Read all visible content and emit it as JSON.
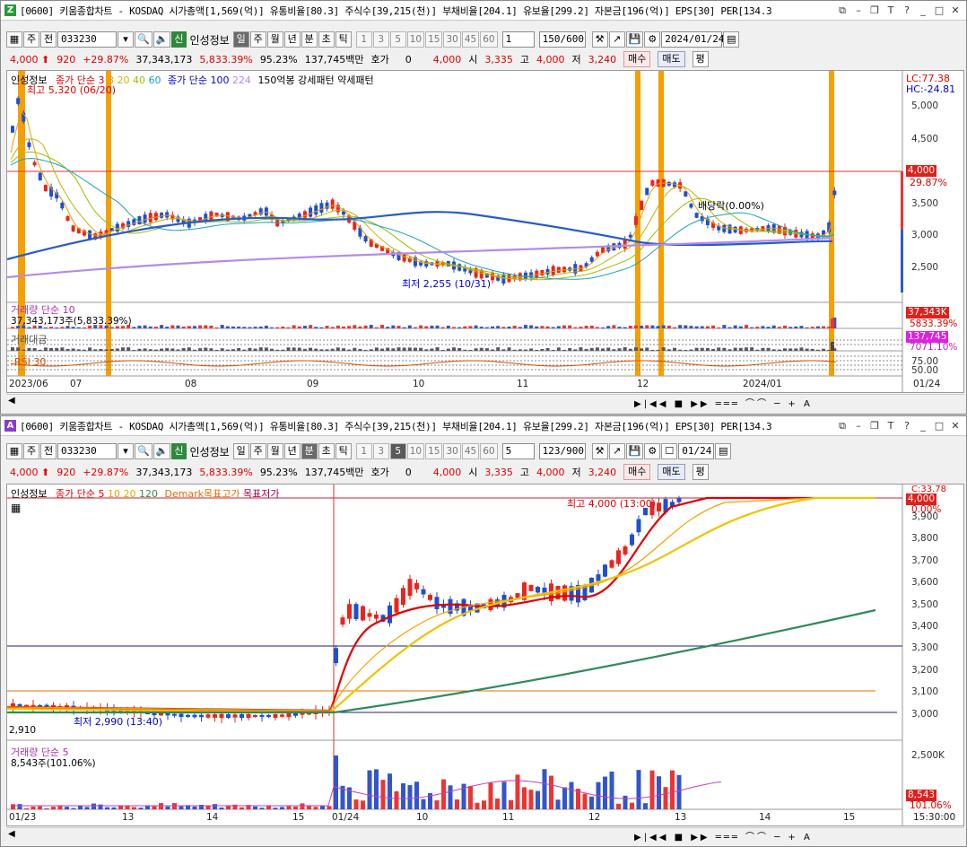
{
  "top": {
    "badge": "Z",
    "title": "[0600] 키움종합차트 - KOSDAQ 시가총액[1,569(억)] 유통비율[80.3] 주식수[39,215(천)] 부채비율[204.1] 유보율[299.2] 자본금[196(억)] EPS[30] PER[134.3",
    "toolbar": {
      "unit": "주",
      "prev": "전",
      "code": "033230",
      "news": "신",
      "name": "인성정보",
      "periods": [
        "일",
        "주",
        "월",
        "년",
        "분",
        "초",
        "틱"
      ],
      "active_period": "일",
      "nums": [
        "1",
        "3",
        "5",
        "10",
        "15",
        "30",
        "45",
        "60"
      ],
      "num_sel": "1",
      "count": "150/600",
      "date": "2024/01/24"
    },
    "quote": {
      "price": "4,000",
      "change": "920",
      "rate": "+29.87%",
      "volume": "37,343,173",
      "vol_rate": "5,833.39%",
      "ratio": "95.23%",
      "amount": "137,745백만",
      "hoga_label": "호가",
      "hoga_val": "0",
      "hoga_price": "4,000",
      "open_label": "시",
      "open": "3,335",
      "high_label": "고",
      "high": "4,000",
      "low_label": "저",
      "low": "3,240",
      "buy": "매수",
      "sell": "매도",
      "eval": "평"
    },
    "legend": {
      "name": "인성정보",
      "ma_label": "종가 단순 3",
      "ma_vals": [
        "8",
        "20",
        "40",
        "60"
      ],
      "ma2_label": "종가 단순 100",
      "ma2_val": "224",
      "pattern": "150억봉 강세패턴",
      "pattern2": "약세패턴"
    },
    "annotations": {
      "high": "최고 5,320 (06/20)",
      "low": "최저 2,255 (10/31)",
      "dividend": "배당락(0.00%)"
    },
    "right": {
      "lc": "LC:77.38",
      "hc": "HC:-24.81",
      "price_tag": "4,000",
      "pct_tag": "29.87%",
      "y_ticks": [
        "5,000",
        "4,500",
        "4,000",
        "3,500",
        "3,000",
        "2,500"
      ]
    },
    "vol_panel": {
      "label": "거래량",
      "ma": "단순 10",
      "value": "37,343,173주(5,833.39%)",
      "tag": "37,343K",
      "tag_pct": "5833.39%"
    },
    "amt_panel": {
      "label": "거래대금",
      "tag": "137,745",
      "tag_pct": "7071.10%"
    },
    "rsi_panel": {
      "label": "RSI 30",
      "ticks": [
        "75.00",
        "50.00"
      ]
    },
    "x_labels": [
      "2023/06",
      "07",
      "08",
      "09",
      "10",
      "11",
      "12",
      "2024/01",
      "01/24"
    ]
  },
  "bottom": {
    "badge": "A",
    "title": "[0600] 키움종합차트 - KOSDAQ 시가총액[1,569(억)] 유통비율[80.3] 주식수[39,215(천)] 부채비율[204.1] 유보율[299.2] 자본금[196(억)] EPS[30] PER[134.3",
    "toolbar": {
      "unit": "주",
      "prev": "전",
      "code": "033230",
      "news": "신",
      "name": "인성정보",
      "periods": [
        "일",
        "주",
        "월",
        "년",
        "분",
        "초",
        "틱"
      ],
      "active_period": "분",
      "nums": [
        "1",
        "3",
        "5",
        "10",
        "15",
        "30",
        "45",
        "60"
      ],
      "num_sel": "5",
      "count": "123/900",
      "date": "01/24"
    },
    "quote": {
      "price": "4,000",
      "change": "920",
      "rate": "+29.87%",
      "volume": "37,343,173",
      "vol_rate": "5,833.39%",
      "ratio": "95.23%",
      "amount": "137,745백만",
      "hoga_label": "호가",
      "hoga_val": "0",
      "hoga_price": "4,000",
      "open_label": "시",
      "open": "3,335",
      "high_label": "고",
      "high": "4,000",
      "low_label": "저",
      "low": "3,240",
      "buy": "매수",
      "sell": "매도",
      "eval": "평"
    },
    "legend": {
      "name": "인성정보",
      "ma_label": "종가 단순 5",
      "ma_vals": [
        "10",
        "20",
        "120"
      ],
      "demark": "Demark목표고가",
      "demark2": "목표저가"
    },
    "annotations": {
      "high": "최고 4,000 (13:00)",
      "low": "최저 2,990 (13:40)",
      "left_val": "2,910"
    },
    "right": {
      "c": "C:33.78",
      "price_tag": "4,000",
      "pct_tag": "0.00%",
      "y_ticks": [
        "3,900",
        "3,800",
        "3,700",
        "3,600",
        "3,500",
        "3,400",
        "3,300",
        "3,200",
        "3,100",
        "3,000"
      ]
    },
    "vol_panel": {
      "label": "거래량",
      "ma": "단순 5",
      "value": "8,543주(101.06%)",
      "tag": "8,543",
      "tag_pct": "101.06%",
      "tick": "2,500K"
    },
    "x_labels": [
      "01/23",
      "13",
      "14",
      "15",
      "01/24",
      "10",
      "11",
      "12",
      "13",
      "14",
      "15",
      "15:30:00"
    ]
  },
  "colors": {
    "up": "#e8251e",
    "down": "#1f4fd0",
    "ma_orange": "#f5a000",
    "ma_green": "#2f8a5a",
    "ma_blue": "#2a5cc7",
    "ma_violet": "#b48be8"
  }
}
